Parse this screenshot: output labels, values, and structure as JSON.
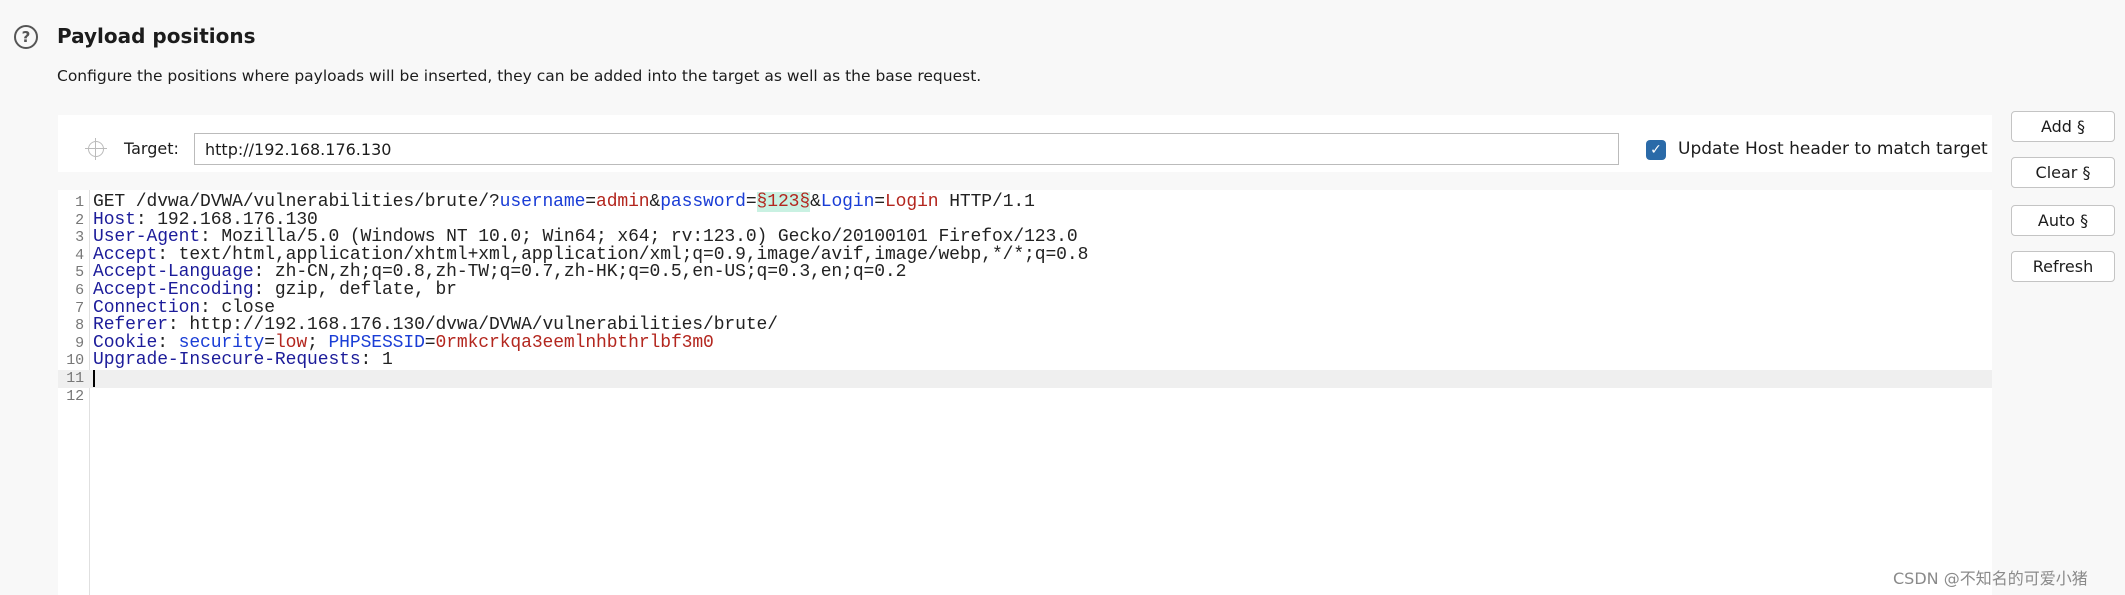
{
  "header": {
    "help_icon": "question-circle-icon",
    "title": "Payload positions",
    "description": "Configure the positions where payloads will be inserted, they can be added into the target as well as the base request."
  },
  "target": {
    "icon": "crosshair-icon",
    "label": "Target:",
    "value": "http://192.168.176.130",
    "update_host": {
      "checked": true,
      "label": "Update Host header to match target",
      "color": "#2a6aa8"
    }
  },
  "buttons": {
    "add": "Add §",
    "clear": "Clear §",
    "auto": "Auto §",
    "refresh": "Refresh"
  },
  "editor": {
    "current_line": 11,
    "lines": [
      {
        "n": "1",
        "segs": [
          [
            "plain",
            "GET /dvwa/DVWA/vulnerabilities/brute/?"
          ],
          [
            "pname",
            "username"
          ],
          [
            "plain",
            "="
          ],
          [
            "pval",
            "admin"
          ],
          [
            "plain",
            "&"
          ],
          [
            "pname",
            "password"
          ],
          [
            "plain",
            "="
          ],
          [
            "payload",
            "§123§"
          ],
          [
            "plain",
            "&"
          ],
          [
            "pname",
            "Login"
          ],
          [
            "plain",
            "="
          ],
          [
            "pval",
            "Login"
          ],
          [
            "plain",
            " HTTP/1.1"
          ]
        ]
      },
      {
        "n": "2",
        "segs": [
          [
            "key",
            "Host"
          ],
          [
            "plain",
            ": 192.168.176.130"
          ]
        ]
      },
      {
        "n": "3",
        "segs": [
          [
            "key",
            "User-Agent"
          ],
          [
            "plain",
            ": Mozilla/5.0 (Windows NT 10.0; Win64; x64; rv:123.0) Gecko/20100101 Firefox/123.0"
          ]
        ]
      },
      {
        "n": "4",
        "segs": [
          [
            "key",
            "Accept"
          ],
          [
            "plain",
            ": text/html,application/xhtml+xml,application/xml;q=0.9,image/avif,image/webp,*/*;q=0.8"
          ]
        ]
      },
      {
        "n": "5",
        "segs": [
          [
            "key",
            "Accept-Language"
          ],
          [
            "plain",
            ": zh-CN,zh;q=0.8,zh-TW;q=0.7,zh-HK;q=0.5,en-US;q=0.3,en;q=0.2"
          ]
        ]
      },
      {
        "n": "6",
        "segs": [
          [
            "key",
            "Accept-Encoding"
          ],
          [
            "plain",
            ": gzip, deflate, br"
          ]
        ]
      },
      {
        "n": "7",
        "segs": [
          [
            "key",
            "Connection"
          ],
          [
            "plain",
            ": close"
          ]
        ]
      },
      {
        "n": "8",
        "segs": [
          [
            "key",
            "Referer"
          ],
          [
            "plain",
            ": http://192.168.176.130/dvwa/DVWA/vulnerabilities/brute/"
          ]
        ]
      },
      {
        "n": "9",
        "segs": [
          [
            "key",
            "Cookie"
          ],
          [
            "plain",
            ": "
          ],
          [
            "pname",
            "security"
          ],
          [
            "plain",
            "="
          ],
          [
            "pval",
            "low"
          ],
          [
            "plain",
            "; "
          ],
          [
            "pname",
            "PHPSESSID"
          ],
          [
            "plain",
            "="
          ],
          [
            "pval",
            "0rmkcrkqa3eemlnhbthrlbf3m0"
          ]
        ]
      },
      {
        "n": "10",
        "segs": [
          [
            "key",
            "Upgrade-Insecure-Requests"
          ],
          [
            "plain",
            ": 1"
          ]
        ]
      },
      {
        "n": "11",
        "segs": []
      },
      {
        "n": "12",
        "segs": []
      }
    ]
  },
  "watermark": "CSDN @不知名的可爱小猪"
}
